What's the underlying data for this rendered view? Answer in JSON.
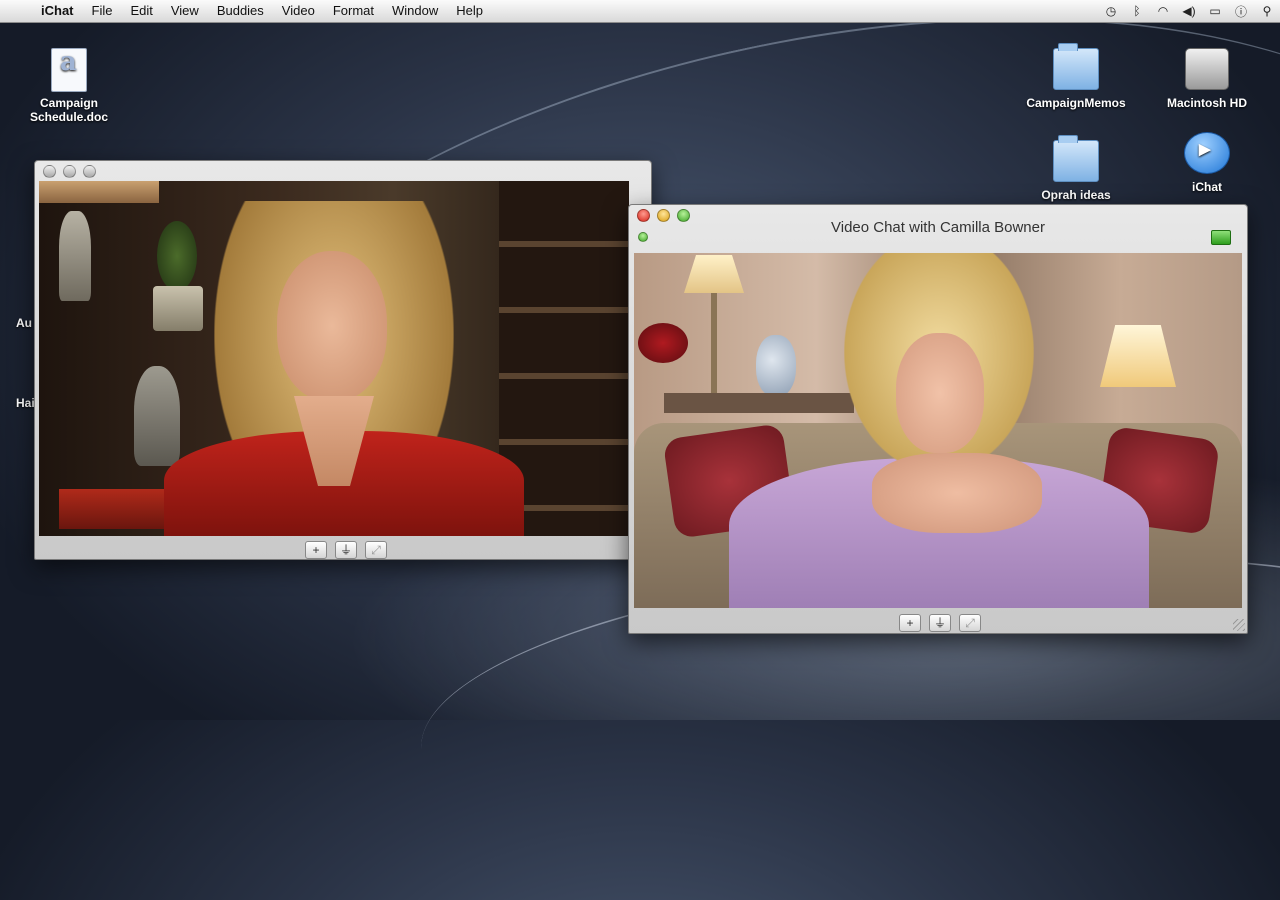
{
  "menubar": {
    "apple_icon": "apple-icon",
    "items": [
      "iChat",
      "File",
      "Edit",
      "View",
      "Buddies",
      "Video",
      "Format",
      "Window",
      "Help"
    ],
    "status_icons": [
      "time-machine-icon",
      "bluetooth-icon",
      "wifi-icon",
      "volume-icon",
      "battery-icon",
      "user-icon",
      "spotlight-icon"
    ]
  },
  "desktop": {
    "left_icons": [
      {
        "label": "Campaign Schedule.doc",
        "icon": "word-document-icon"
      }
    ],
    "edge_labels": [
      "Au",
      "Hai"
    ],
    "right_icons": [
      {
        "label": "CampaignMemos",
        "icon": "folder-icon"
      },
      {
        "label": "Macintosh HD",
        "icon": "hard-drive-icon"
      },
      {
        "label": "Oprah ideas",
        "icon": "folder-icon"
      },
      {
        "label": "iChat",
        "icon": "ichat-icon"
      }
    ]
  },
  "window_left": {
    "title": "",
    "toolbar": [
      "+",
      "⏚",
      "⤢"
    ]
  },
  "window_right": {
    "title": "Video Chat with Camilla Bowner",
    "status_color": "#4caf50",
    "toolbar": [
      "+",
      "⏚",
      "⤢"
    ]
  }
}
